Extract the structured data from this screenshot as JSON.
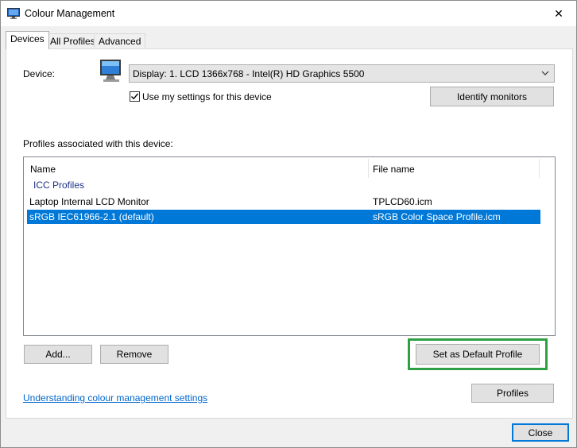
{
  "window": {
    "title": "Colour Management",
    "close_glyph": "✕"
  },
  "tabs": [
    {
      "label": "Devices",
      "active": true
    },
    {
      "label": "All Profiles",
      "active": false
    },
    {
      "label": "Advanced",
      "active": false
    }
  ],
  "device": {
    "label": "Device:",
    "icon": "monitor-icon",
    "selected": "Display: 1. LCD 1366x768 - Intel(R) HD Graphics 5500",
    "use_my_settings_label": "Use my settings for this device",
    "use_my_settings_checked": true,
    "identify_label": "Identify monitors"
  },
  "profiles": {
    "section_label": "Profiles associated with this device:",
    "columns": [
      "Name",
      "File name"
    ],
    "group": "ICC Profiles",
    "rows": [
      {
        "name": "Laptop Internal LCD Monitor",
        "file": "TPLCD60.icm",
        "selected": false
      },
      {
        "name": "sRGB IEC61966-2.1 (default)",
        "file": "sRGB Color Space Profile.icm",
        "selected": true
      }
    ]
  },
  "buttons": {
    "add": "Add...",
    "remove": "Remove",
    "set_default": "Set as Default Profile",
    "profiles": "Profiles",
    "close": "Close"
  },
  "link": {
    "text": "Understanding colour management settings"
  },
  "colors": {
    "selection": "#0078d7",
    "link": "#0066cc",
    "group": "#1e3287",
    "highlight_frame": "#2ea043"
  }
}
